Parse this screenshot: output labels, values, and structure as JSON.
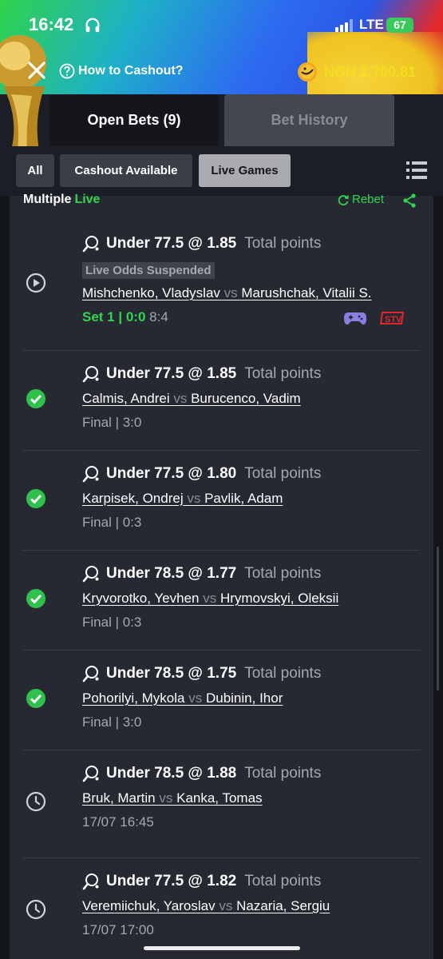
{
  "status_bar": {
    "time": "16:42",
    "network": "LTE",
    "battery": "67"
  },
  "header": {
    "help_text": "How to Cashout?",
    "balance": "NGN 1,700.81",
    "tabs": [
      {
        "label": "Open Bets (9)",
        "active": true
      },
      {
        "label": "Bet History",
        "active": false
      }
    ]
  },
  "filters": [
    {
      "label": "All",
      "active": false
    },
    {
      "label": "Cashout Available",
      "active": false
    },
    {
      "label": "Live Games",
      "active": true
    }
  ],
  "bet": {
    "type_label": "Multiple",
    "live_label": "Live",
    "rebet_label": "Rebet",
    "legs": [
      {
        "selection": "Under 77.5 @ 1.85",
        "market": "Total points",
        "suspended": "Live Odds Suspended",
        "home": "Mishchenko, Vladyslav",
        "vs": "vs",
        "away": "Marushchak, Vitalii S.",
        "status_live": "Set 1 | ",
        "status_score": "0:0",
        "status_extra": " 8:4",
        "icon": "play-icon"
      },
      {
        "selection": "Under 77.5 @ 1.85",
        "market": "Total points",
        "home": "Calmis, Andrei",
        "vs": "vs",
        "away": "Burucenco, Vadim",
        "status": "Final | 3:0",
        "icon": "check-icon"
      },
      {
        "selection": "Under 77.5 @ 1.80",
        "market": "Total points",
        "home": "Karpisek, Ondrej",
        "vs": "vs",
        "away": "Pavlik, Adam",
        "status": "Final | 0:3",
        "icon": "check-icon"
      },
      {
        "selection": "Under 78.5 @ 1.77",
        "market": "Total points",
        "home": "Kryvorotko, Yevhen",
        "vs": "vs",
        "away": "Hrymovskyi, Oleksii",
        "status": "Final | 0:3",
        "icon": "check-icon"
      },
      {
        "selection": "Under 78.5 @ 1.75",
        "market": "Total points",
        "home": "Pohorilyi, Mykola",
        "vs": "vs",
        "away": "Dubinin, Ihor",
        "status": "Final | 3:0",
        "icon": "check-icon"
      },
      {
        "selection": "Under 78.5 @ 1.88",
        "market": "Total points",
        "home": "Bruk, Martin",
        "vs": "vs",
        "away": "Kanka, Tomas",
        "status": "17/07 16:45",
        "icon": "clock-icon"
      },
      {
        "selection": "Under 77.5 @ 1.82",
        "market": "Total points",
        "home": "Veremiichuk, Yaroslav",
        "vs": "vs",
        "away": "Nazaria, Sergiu",
        "status": "17/07 17:00",
        "icon": "clock-icon"
      }
    ]
  },
  "colors": {
    "accent_green": "#2fd74f",
    "balance_yellow": "#f4dd1f",
    "card_bg": "#262932",
    "page_bg": "#14161c"
  }
}
